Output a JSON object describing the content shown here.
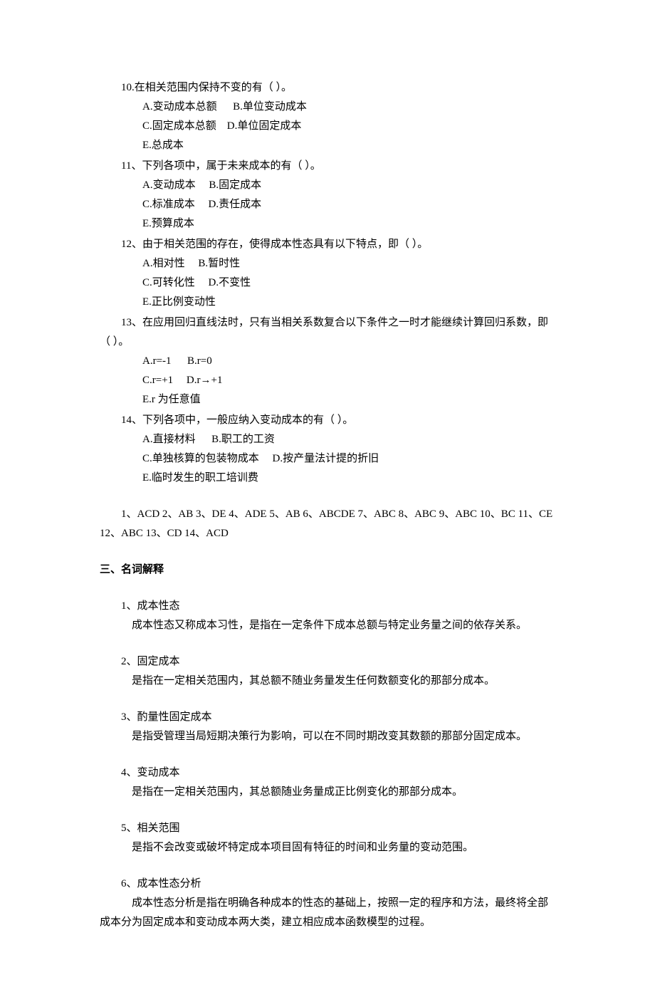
{
  "questions": {
    "q10": {
      "stem": "10.在相关范围内保持不变的有（ ）。",
      "optA": "A.变动成本总额      B.单位变动成本",
      "optC": "C.固定成本总额    D.单位固定成本",
      "optE": "E.总成本"
    },
    "q11": {
      "stem": "11、下列各项中，属于未来成本的有（ ）。",
      "optA": "A.变动成本     B.固定成本",
      "optC": "C.标准成本     D.责任成本",
      "optE": "E.预算成本"
    },
    "q12": {
      "stem": "12、由于相关范围的存在，使得成本性态具有以下特点，即（ ）。",
      "optA": "A.相对性     B.暂时性",
      "optC": "C.可转化性     D.不变性",
      "optE": "E.正比例变动性"
    },
    "q13": {
      "stem1": "13、在应用回归直线法时，只有当相关系数复合以下条件之一时才能继续计算回归系数，即",
      "stem2": "（ ）。",
      "optA": "A.r=-1      B.r=0",
      "optC": "C.r=+1     D.r→+1",
      "optE": "E.r 为任意值"
    },
    "q14": {
      "stem": "14、下列各项中，一般应纳入变动成本的有（ ）。",
      "optA": "A.直接材料      B.职工的工资",
      "optC": "C.单独核算的包装物成本     D.按产量法计提的折旧",
      "optE": "E.临时发生的职工培训费"
    }
  },
  "answers": {
    "line1": "1、ACD 2、AB 3、DE 4、ADE 5、AB 6、ABCDE 7、ABC   8、ABC 9、ABC 10、BC 11、CE",
    "line2": "12、ABC 13、CD 14、ACD"
  },
  "section3": {
    "heading": "三、名词解释",
    "terms": {
      "t1": {
        "title": "1、成本性态",
        "def": "成本性态又称成本习性，是指在一定条件下成本总额与特定业务量之间的依存关系。"
      },
      "t2": {
        "title": "2、固定成本",
        "def": "是指在一定相关范围内，其总额不随业务量发生任何数额变化的那部分成本。"
      },
      "t3": {
        "title": "3、酌量性固定成本",
        "def": "是指受管理当局短期决策行为影响，可以在不同时期改变其数额的那部分固定成本。"
      },
      "t4": {
        "title": "4、变动成本",
        "def": "是指在一定相关范围内，其总额随业务量成正比例变化的那部分成本。"
      },
      "t5": {
        "title": "5、相关范围",
        "def": "是指不会改变或破坏特定成本项目固有特征的时间和业务量的变动范围。"
      },
      "t6": {
        "title": "6、成本性态分析",
        "def1": "成本性态分析是指在明确各种成本的性态的基础上，按照一定的程序和方法，最终将全部",
        "def2": "成本分为固定成本和变动成本两大类，建立相应成本函数模型的过程。"
      }
    }
  }
}
